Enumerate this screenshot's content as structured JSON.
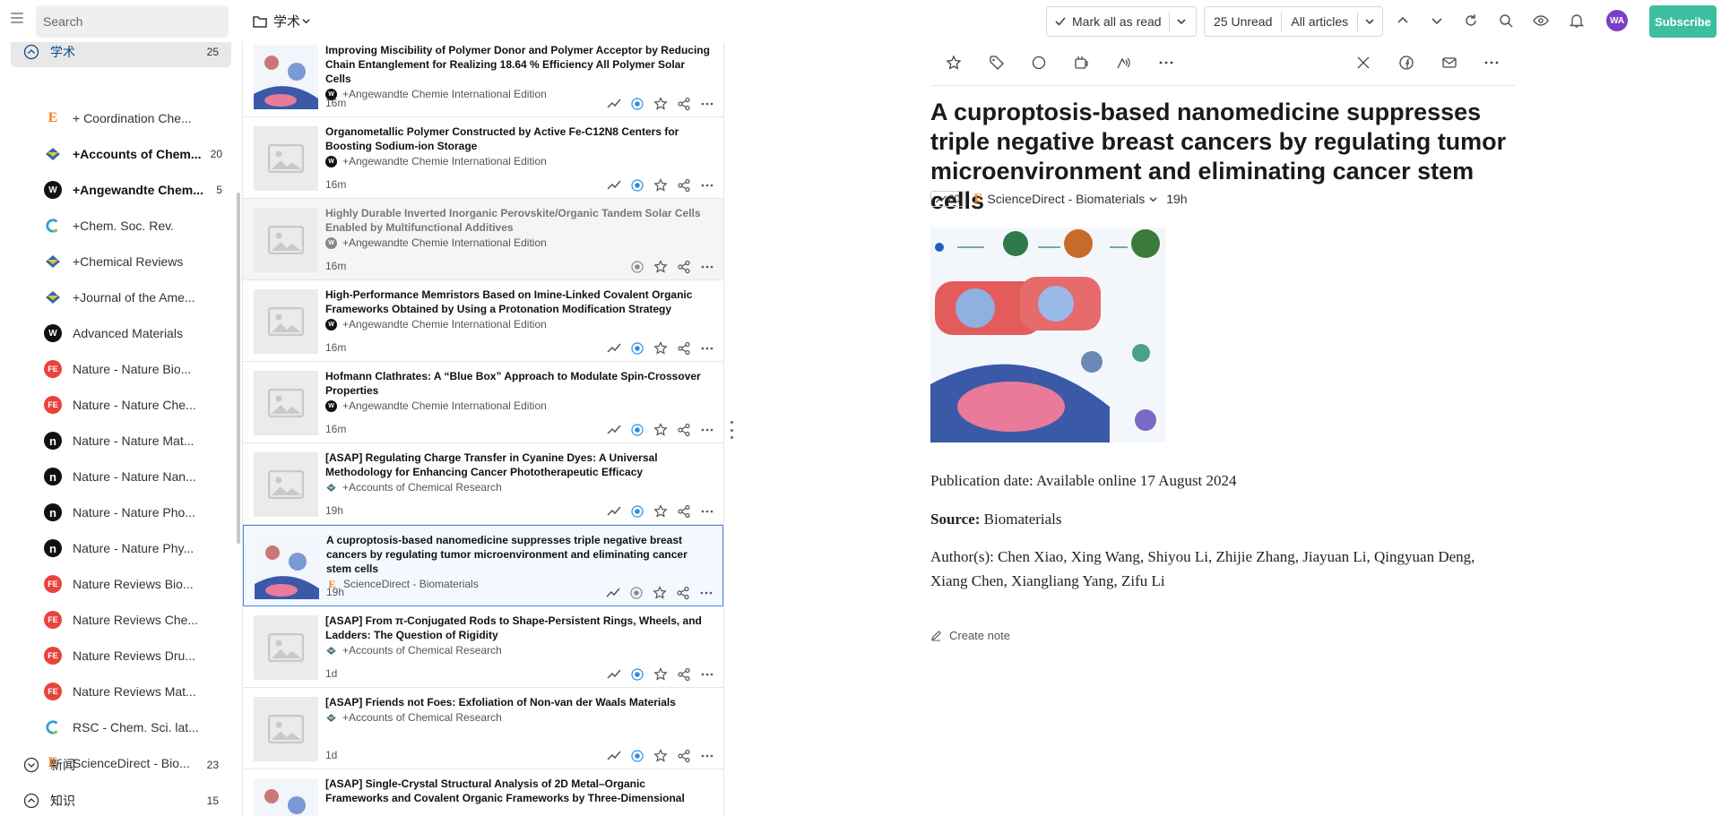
{
  "topbar": {
    "search_placeholder": "Search",
    "folder": "学术",
    "mark_all_read": "Mark all as read",
    "unread": "25 Unread",
    "filter": "All articles",
    "avatar": "WA",
    "subscribe": "Subscribe"
  },
  "sidebar": {
    "groups": [
      {
        "label": "学术",
        "count": "25"
      },
      {
        "label": "新闻",
        "count": "23"
      },
      {
        "label": "知识",
        "count": "15"
      }
    ],
    "feeds": [
      {
        "label": "+ Coordination Che...",
        "count": "",
        "icon": "E",
        "color": "#f5821f",
        "bold": false
      },
      {
        "label": "+Accounts of Chem...",
        "count": "20",
        "icon": "acs",
        "color": "#2f6bb3",
        "bold": true
      },
      {
        "label": "+Angewandte Chem...",
        "count": "5",
        "icon": "W",
        "color": "#111111",
        "bold": true
      },
      {
        "label": "+Chem. Soc. Rev.",
        "count": "",
        "icon": "C",
        "color": "#2a9fd6",
        "bold": false
      },
      {
        "label": "+Chemical Reviews",
        "count": "",
        "icon": "acs",
        "color": "#2f6bb3",
        "bold": false
      },
      {
        "label": "+Journal of the Ame...",
        "count": "",
        "icon": "acs",
        "color": "#2f6bb3",
        "bold": false
      },
      {
        "label": "Advanced Materials",
        "count": "",
        "icon": "W",
        "color": "#111111",
        "bold": false
      },
      {
        "label": "Nature - Nature Bio...",
        "count": "",
        "icon": "FE",
        "color": "#e8443a",
        "bold": false
      },
      {
        "label": "Nature - Nature Che...",
        "count": "",
        "icon": "FE",
        "color": "#e8443a",
        "bold": false
      },
      {
        "label": "Nature - Nature Mat...",
        "count": "",
        "icon": "n",
        "color": "#111111",
        "bold": false
      },
      {
        "label": "Nature - Nature Nan...",
        "count": "",
        "icon": "n",
        "color": "#111111",
        "bold": false
      },
      {
        "label": "Nature - Nature Pho...",
        "count": "",
        "icon": "n",
        "color": "#111111",
        "bold": false
      },
      {
        "label": "Nature - Nature Phy...",
        "count": "",
        "icon": "n",
        "color": "#111111",
        "bold": false
      },
      {
        "label": "Nature Reviews Bio...",
        "count": "",
        "icon": "FE",
        "color": "#e8443a",
        "bold": false
      },
      {
        "label": "Nature Reviews Che...",
        "count": "",
        "icon": "FE",
        "color": "#e8443a",
        "bold": false
      },
      {
        "label": "Nature Reviews Dru...",
        "count": "",
        "icon": "FE",
        "color": "#e8443a",
        "bold": false
      },
      {
        "label": "Nature Reviews Mat...",
        "count": "",
        "icon": "FE",
        "color": "#e8443a",
        "bold": false
      },
      {
        "label": "RSC - Chem. Sci. lat...",
        "count": "",
        "icon": "C",
        "color": "#2a9fd6",
        "bold": false
      },
      {
        "label": "ScienceDirect - Bio...",
        "count": "",
        "icon": "E",
        "color": "#f5821f",
        "bold": false
      }
    ]
  },
  "articles": [
    {
      "title": "Improving Miscibility of Polymer Donor and Polymer Acceptor by Reducing Chain Entanglement for Realizing 18.64 % Efficiency All Polymer Solar Cells",
      "source": "+Angewandte Chemie International Edition",
      "time": "16m",
      "state": "unread",
      "thumb": "figure"
    },
    {
      "title": "Organometallic Polymer Constructed by Active Fe-C12N8 Centers for Boosting Sodium-ion Storage",
      "source": "+Angewandte Chemie International Edition",
      "time": "16m",
      "state": "unread",
      "thumb": "placeholder"
    },
    {
      "title": "Highly Durable Inverted Inorganic Perovskite/Organic Tandem Solar Cells Enabled by Multifunctional Additives",
      "source": "+Angewandte Chemie International Edition",
      "time": "16m",
      "state": "read",
      "thumb": "placeholder"
    },
    {
      "title": "High-Performance Memristors Based on Imine-Linked Covalent Organic Frameworks Obtained by Using a Protonation Modification Strategy",
      "source": "+Angewandte Chemie International Edition",
      "time": "16m",
      "state": "unread",
      "thumb": "placeholder"
    },
    {
      "title": "Hofmann Clathrates: A “Blue Box” Approach to Modulate Spin-Crossover Properties",
      "source": "+Angewandte Chemie International Edition",
      "time": "16m",
      "state": "unread",
      "thumb": "placeholder"
    },
    {
      "title": "[ASAP] Regulating Charge Transfer in Cyanine Dyes: A Universal Methodology for Enhancing Cancer Phototherapeutic Efficacy",
      "source": "+Accounts of Chemical Research",
      "time": "19h",
      "state": "unread",
      "thumb": "placeholder"
    },
    {
      "title": "A cuproptosis-based nanomedicine suppresses triple negative breast cancers by regulating tumor microenvironment and eliminating cancer stem cells",
      "source": "ScienceDirect - Biomaterials",
      "time": "19h",
      "state": "selected",
      "thumb": "figure"
    },
    {
      "title": "[ASAP] From π-Conjugated Rods to Shape-Persistent Rings, Wheels, and Ladders: The Question of Rigidity",
      "source": "+Accounts of Chemical Research",
      "time": "1d",
      "state": "unread",
      "thumb": "placeholder"
    },
    {
      "title": "[ASAP] Friends not Foes: Exfoliation of Non-van der Waals Materials",
      "source": "+Accounts of Chemical Research",
      "time": "1d",
      "state": "unread",
      "thumb": "placeholder"
    },
    {
      "title": "[ASAP] Single-Crystal Structural Analysis of 2D Metal–Organic Frameworks and Covalent Organic Frameworks by Three-Dimensional",
      "source": "",
      "time": "",
      "state": "unread",
      "thumb": "figure"
    }
  ],
  "reader": {
    "title": "A cuproptosis-based nanomedicine suppresses triple negative breast cancers by regulating tumor microenvironment and eliminating cancer stem cells",
    "trend": "80",
    "source": "ScienceDirect - Biomaterials",
    "time": "19h",
    "pub_date": "Publication date: Available online 17 August 2024",
    "source_label": "Source:",
    "source_value": "Biomaterials",
    "authors": "Author(s): Chen Xiao, Xing Wang, Shiyou Li, Zhijie Zhang, Jiayuan Li, Qingyuan Deng, Xiang Chen, Xiangliang Yang, Zifu Li",
    "create_note": "Create note"
  },
  "colors": {
    "accent": "#3dbf9f",
    "selected_border": "#4a86e8",
    "unread_dot": "#2a8de0",
    "avatar": "#7b3fc7"
  }
}
